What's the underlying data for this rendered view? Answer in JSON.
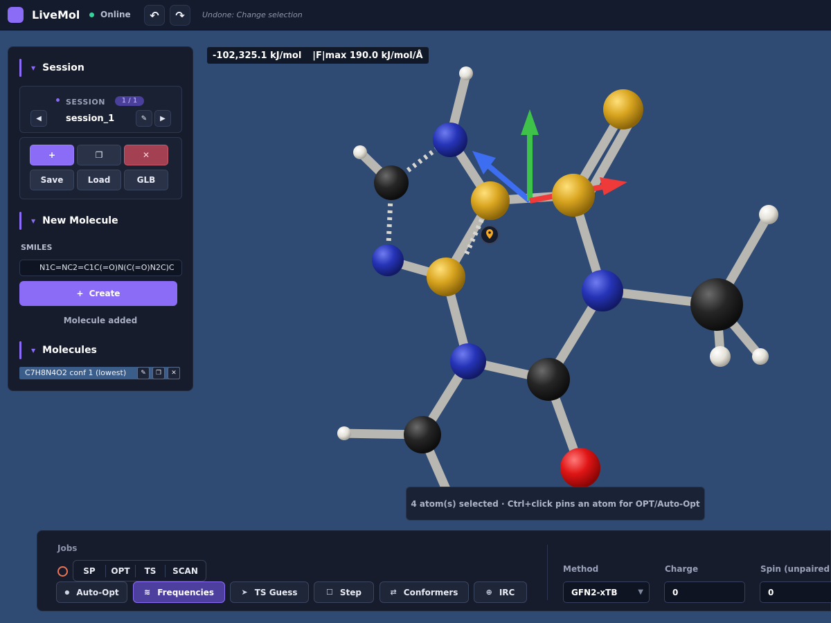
{
  "app": {
    "name": "LiveMol",
    "status": "Online",
    "undo_icon": "↶",
    "redo_icon": "↷",
    "undo_message": "Undone: Change selection"
  },
  "sidebar": {
    "session": {
      "title": "Session",
      "label": "SESSION",
      "count": "1 / 1",
      "name": "session_1",
      "prev_icon": "◀",
      "next_icon": "▶",
      "rename_icon": "✎"
    },
    "actions": {
      "add": "+",
      "duplicate": "❐",
      "delete": "✕",
      "save": "Save",
      "load": "Load",
      "glb": "GLB"
    },
    "new_molecule": {
      "title": "New Molecule",
      "smiles_label": "SMILES",
      "smiles_value": "N1C=NC2=C1C(=O)N(C(=O)N2C)C",
      "create_label": "Create",
      "status_message": "Molecule added"
    },
    "molecules": {
      "title": "Molecules",
      "items": [
        {
          "label": "C7H8N4O2 conf 1 (lowest)"
        }
      ]
    }
  },
  "viewport": {
    "energy": "-102,325.1 kJ/mol",
    "fmax": "|F|max 190.0 kJ/mol/Å",
    "toast": "4 atom(s) selected · Ctrl+click pins an atom for OPT/Auto-Opt"
  },
  "jobs": {
    "title": "Jobs",
    "modes": [
      "SP",
      "OPT",
      "TS",
      "SCAN"
    ],
    "buttons": [
      {
        "label": "Auto-Opt",
        "icon": "●"
      },
      {
        "label": "Frequencies",
        "icon": "≋"
      },
      {
        "label": "TS Guess",
        "icon": "➤"
      },
      {
        "label": "Step",
        "icon": "☐"
      },
      {
        "label": "Conformers",
        "icon": "⇄"
      },
      {
        "label": "IRC",
        "icon": "⊕"
      }
    ],
    "method_label": "Method",
    "method_value": "GFN2-xTB",
    "charge_label": "Charge",
    "charge_value": "0",
    "spin_label": "Spin (unpaired e",
    "spin_value": "0"
  },
  "colors": {
    "accent": "#8b6cf6",
    "viewport_bg": "#2f4a73",
    "panel_bg": "#161c2c",
    "online": "#34d399"
  }
}
